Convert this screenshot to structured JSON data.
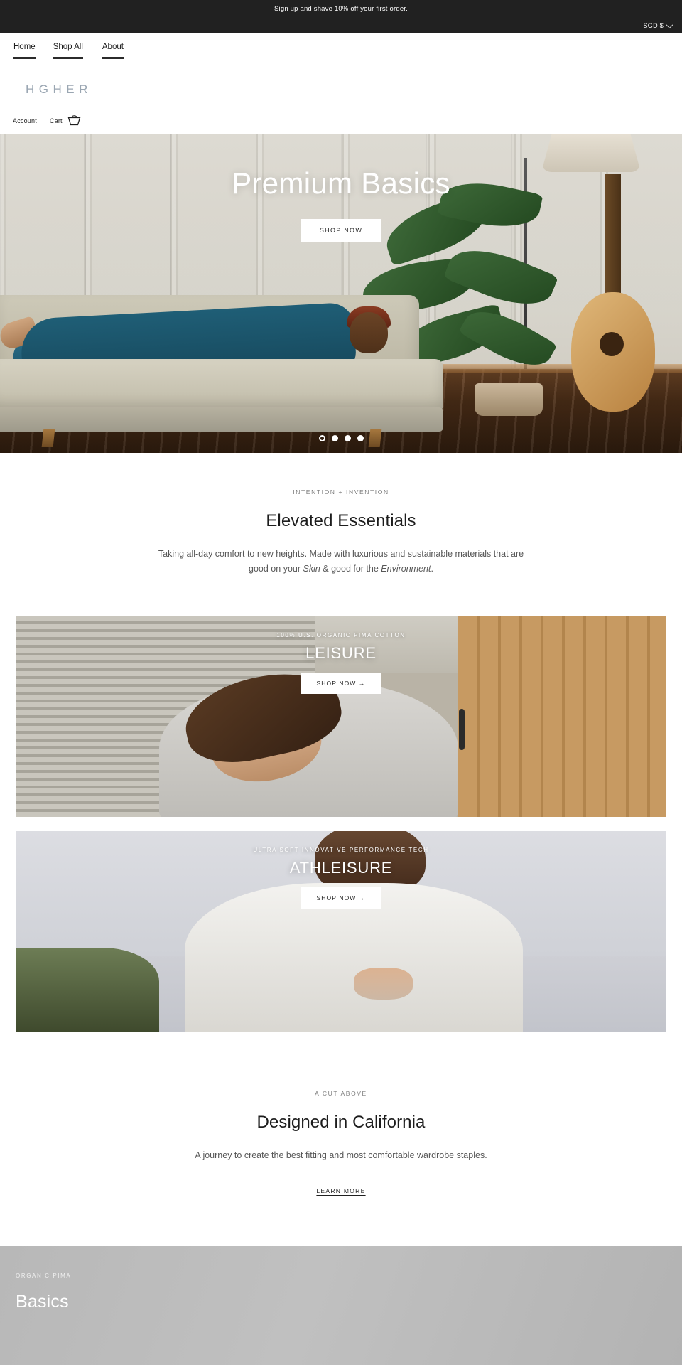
{
  "announcement": {
    "text": "Sign up and shave 10% off your first order.",
    "currency_label": "SGD $",
    "chevron_icon": "chevron-down-icon"
  },
  "nav": {
    "items": [
      {
        "label": "Home"
      },
      {
        "label": "Shop All"
      },
      {
        "label": "About"
      }
    ]
  },
  "brand": {
    "logo": "HGHER",
    "logo_color": "#9aa6b2",
    "account_label": "Account",
    "cart_label": "Cart",
    "cart_icon": "shopping-basket-icon"
  },
  "hero": {
    "title": "Premium Basics",
    "cta_label": "SHOP NOW",
    "slides_total": 4,
    "active_slide": 1
  },
  "intro": {
    "eyebrow": "INTENTION + INVENTION",
    "title": "Elevated Essentials",
    "body_line1": "Taking all-day comfort to new heights. Made with luxurious and sustainable",
    "body_line2_pre": "materials that are good on your ",
    "body_em1": "Skin",
    "body_line2_mid": " & good for the ",
    "body_em2": "Environment",
    "body_line2_post": "."
  },
  "cards": [
    {
      "eyebrow": "100% U.S. ORGANIC PIMA COTTON",
      "title": "LEISURE",
      "cta_label": "SHOP NOW →"
    },
    {
      "eyebrow": "ULTRA SOFT INNOVATIVE PERFORMANCE TECH",
      "title": "ATHLEISURE",
      "cta_label": "SHOP NOW →"
    }
  ],
  "designed": {
    "eyebrow": "A CUT ABOVE",
    "title": "Designed in California",
    "body": "A journey to create the best fitting and most comfortable wardrobe staples.",
    "link_label": "LEARN MORE"
  },
  "bottom_banner": {
    "eyebrow": "ORGANIC PIMA",
    "title": "Basics"
  }
}
